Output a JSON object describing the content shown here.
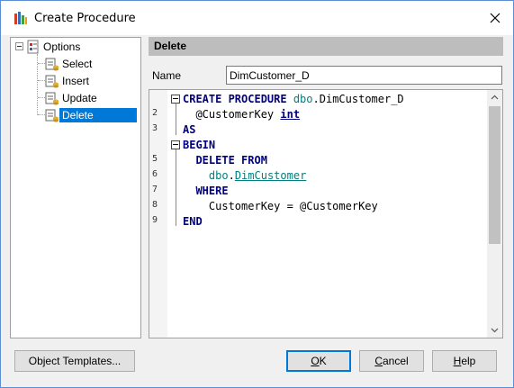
{
  "window": {
    "title": "Create Procedure"
  },
  "tree": {
    "root": "Options",
    "items": [
      {
        "label": "Select",
        "selected": false
      },
      {
        "label": "Insert",
        "selected": false
      },
      {
        "label": "Update",
        "selected": false
      },
      {
        "label": "Delete",
        "selected": true
      }
    ]
  },
  "panel": {
    "header": "Delete",
    "name_label": "Name",
    "name_value": "DimCustomer_D"
  },
  "editor": {
    "lines": [
      {
        "num": "",
        "tokens": [
          {
            "t": "CREATE PROCEDURE ",
            "c": "kw"
          },
          {
            "t": "dbo",
            "c": "schema"
          },
          {
            "t": ".DimCustomer_D",
            "c": "plain"
          }
        ]
      },
      {
        "num": "2",
        "tokens": [
          {
            "t": "  @CustomerKey ",
            "c": "var"
          },
          {
            "t": "int",
            "c": "type"
          }
        ]
      },
      {
        "num": "3",
        "tokens": [
          {
            "t": "AS",
            "c": "kw"
          }
        ]
      },
      {
        "num": "",
        "tokens": [
          {
            "t": "BEGIN",
            "c": "kw"
          }
        ]
      },
      {
        "num": "5",
        "tokens": [
          {
            "t": "  DELETE FROM",
            "c": "kw"
          }
        ]
      },
      {
        "num": "6",
        "tokens": [
          {
            "t": "    ",
            "c": "plain"
          },
          {
            "t": "dbo",
            "c": "schema"
          },
          {
            "t": ".",
            "c": "plain"
          },
          {
            "t": "DimCustomer",
            "c": "obj"
          }
        ]
      },
      {
        "num": "7",
        "tokens": [
          {
            "t": "  WHERE",
            "c": "kw"
          }
        ]
      },
      {
        "num": "8",
        "tokens": [
          {
            "t": "    CustomerKey = @CustomerKey",
            "c": "var"
          }
        ]
      },
      {
        "num": "9",
        "tokens": [
          {
            "t": "END",
            "c": "kw"
          }
        ]
      }
    ]
  },
  "buttons": {
    "object_templates": "Object Templates...",
    "ok_pre": "",
    "ok_mnemonic": "O",
    "ok_post": "K",
    "cancel_pre": "",
    "cancel_mnemonic": "C",
    "cancel_post": "ancel",
    "help_pre": "",
    "help_mnemonic": "H",
    "help_post": "elp"
  },
  "icons": {
    "app": "database-procedure-icon",
    "close": "close-icon",
    "options": "options-icon",
    "procedure": "procedure-icon"
  }
}
